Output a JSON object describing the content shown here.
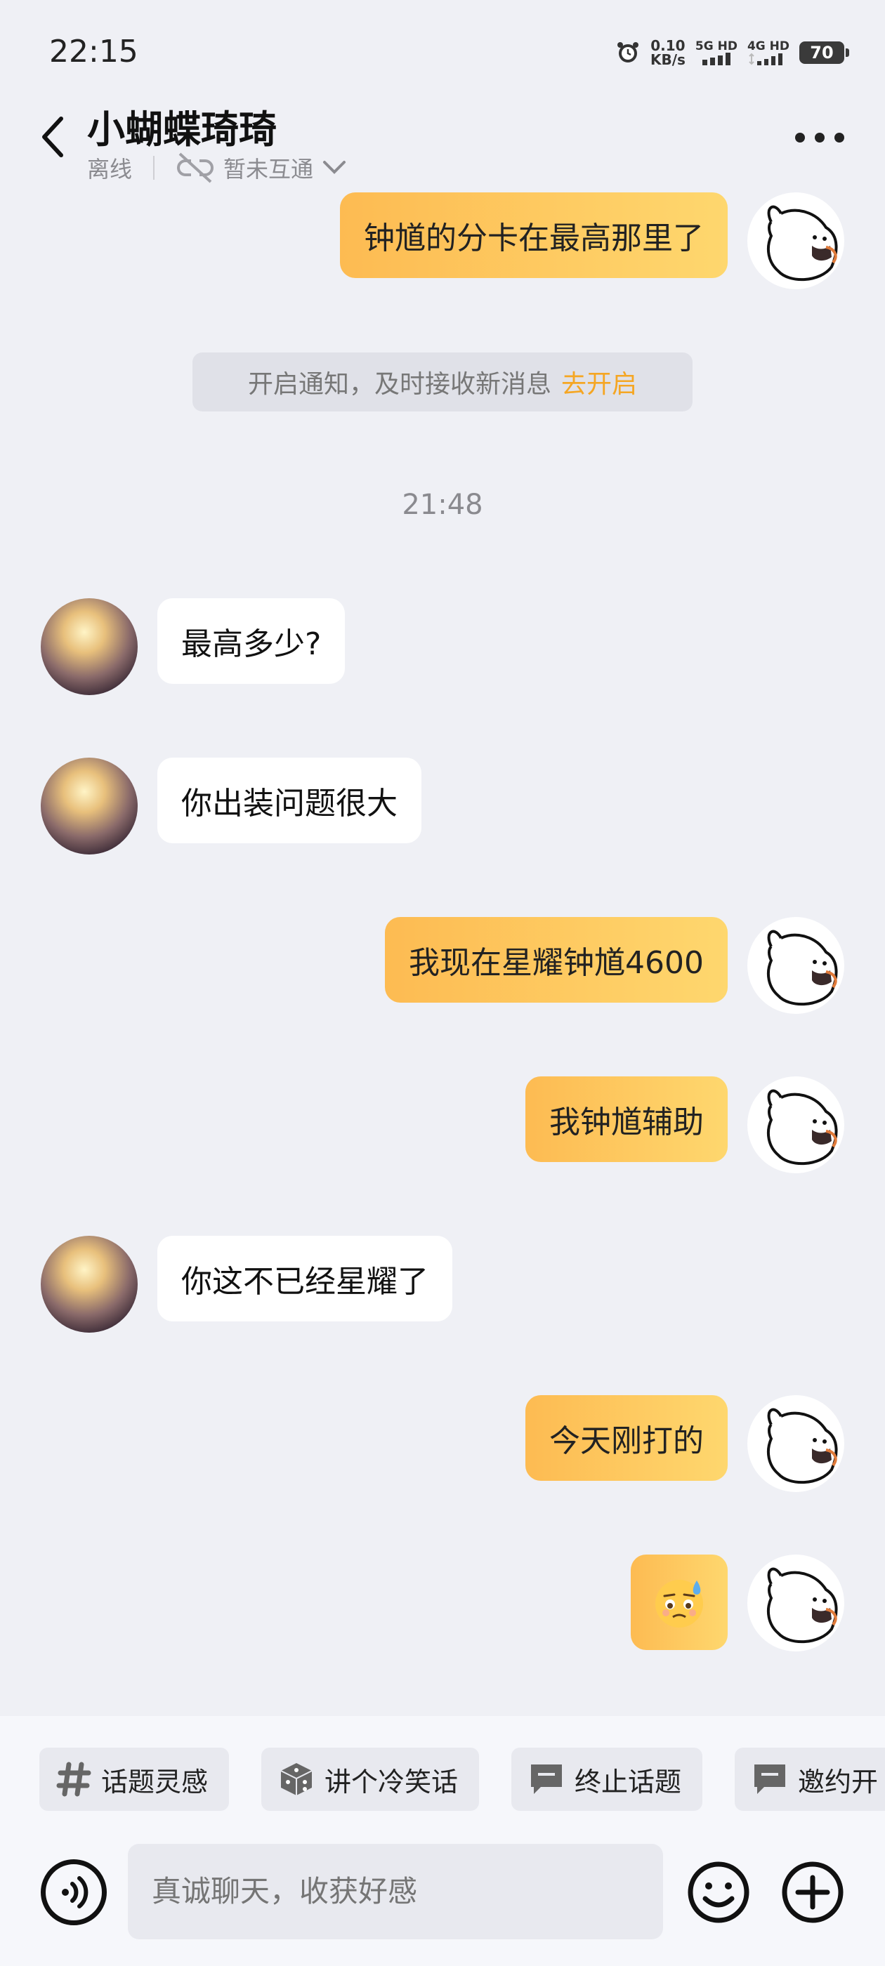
{
  "status_bar": {
    "time": "22:15",
    "net_speed_value": "0.10",
    "net_speed_unit": "KB/s",
    "sim1_label": "5G HD",
    "sim2_label": "4G HD",
    "battery": "70"
  },
  "header": {
    "contact_name": "小蝴蝶琦琦",
    "online_status": "离线",
    "mutual_status": "暂未互通"
  },
  "notice": {
    "text": "开启通知，及时接收新消息",
    "action": "去开启"
  },
  "timestamp": "21:48",
  "messages": [
    {
      "side": "me",
      "text": "钟馗的分卡在最高那里了"
    },
    {
      "side": "them",
      "text": "最高多少?"
    },
    {
      "side": "them",
      "text": "你出装问题很大"
    },
    {
      "side": "me",
      "text": "我现在星耀钟馗4600"
    },
    {
      "side": "me",
      "text": "我钟馗辅助"
    },
    {
      "side": "them",
      "text": "你这不已经星耀了"
    },
    {
      "side": "me",
      "text": "今天刚打的"
    },
    {
      "side": "me",
      "text": "🥲"
    }
  ],
  "quick_actions": [
    {
      "label": "话题灵感",
      "icon": "hashtag-icon"
    },
    {
      "label": "讲个冷笑话",
      "icon": "dice-icon"
    },
    {
      "label": "终止话题",
      "icon": "chat-bubble-icon"
    },
    {
      "label": "邀约开",
      "icon": "chat-bubble-icon"
    }
  ],
  "input": {
    "placeholder": "真诚聊天，收获好感"
  },
  "colors": {
    "accent": "#f5a623",
    "my_bubble_start": "#fdbb52",
    "my_bubble_end": "#fed76e",
    "background": "#eff0f5"
  }
}
